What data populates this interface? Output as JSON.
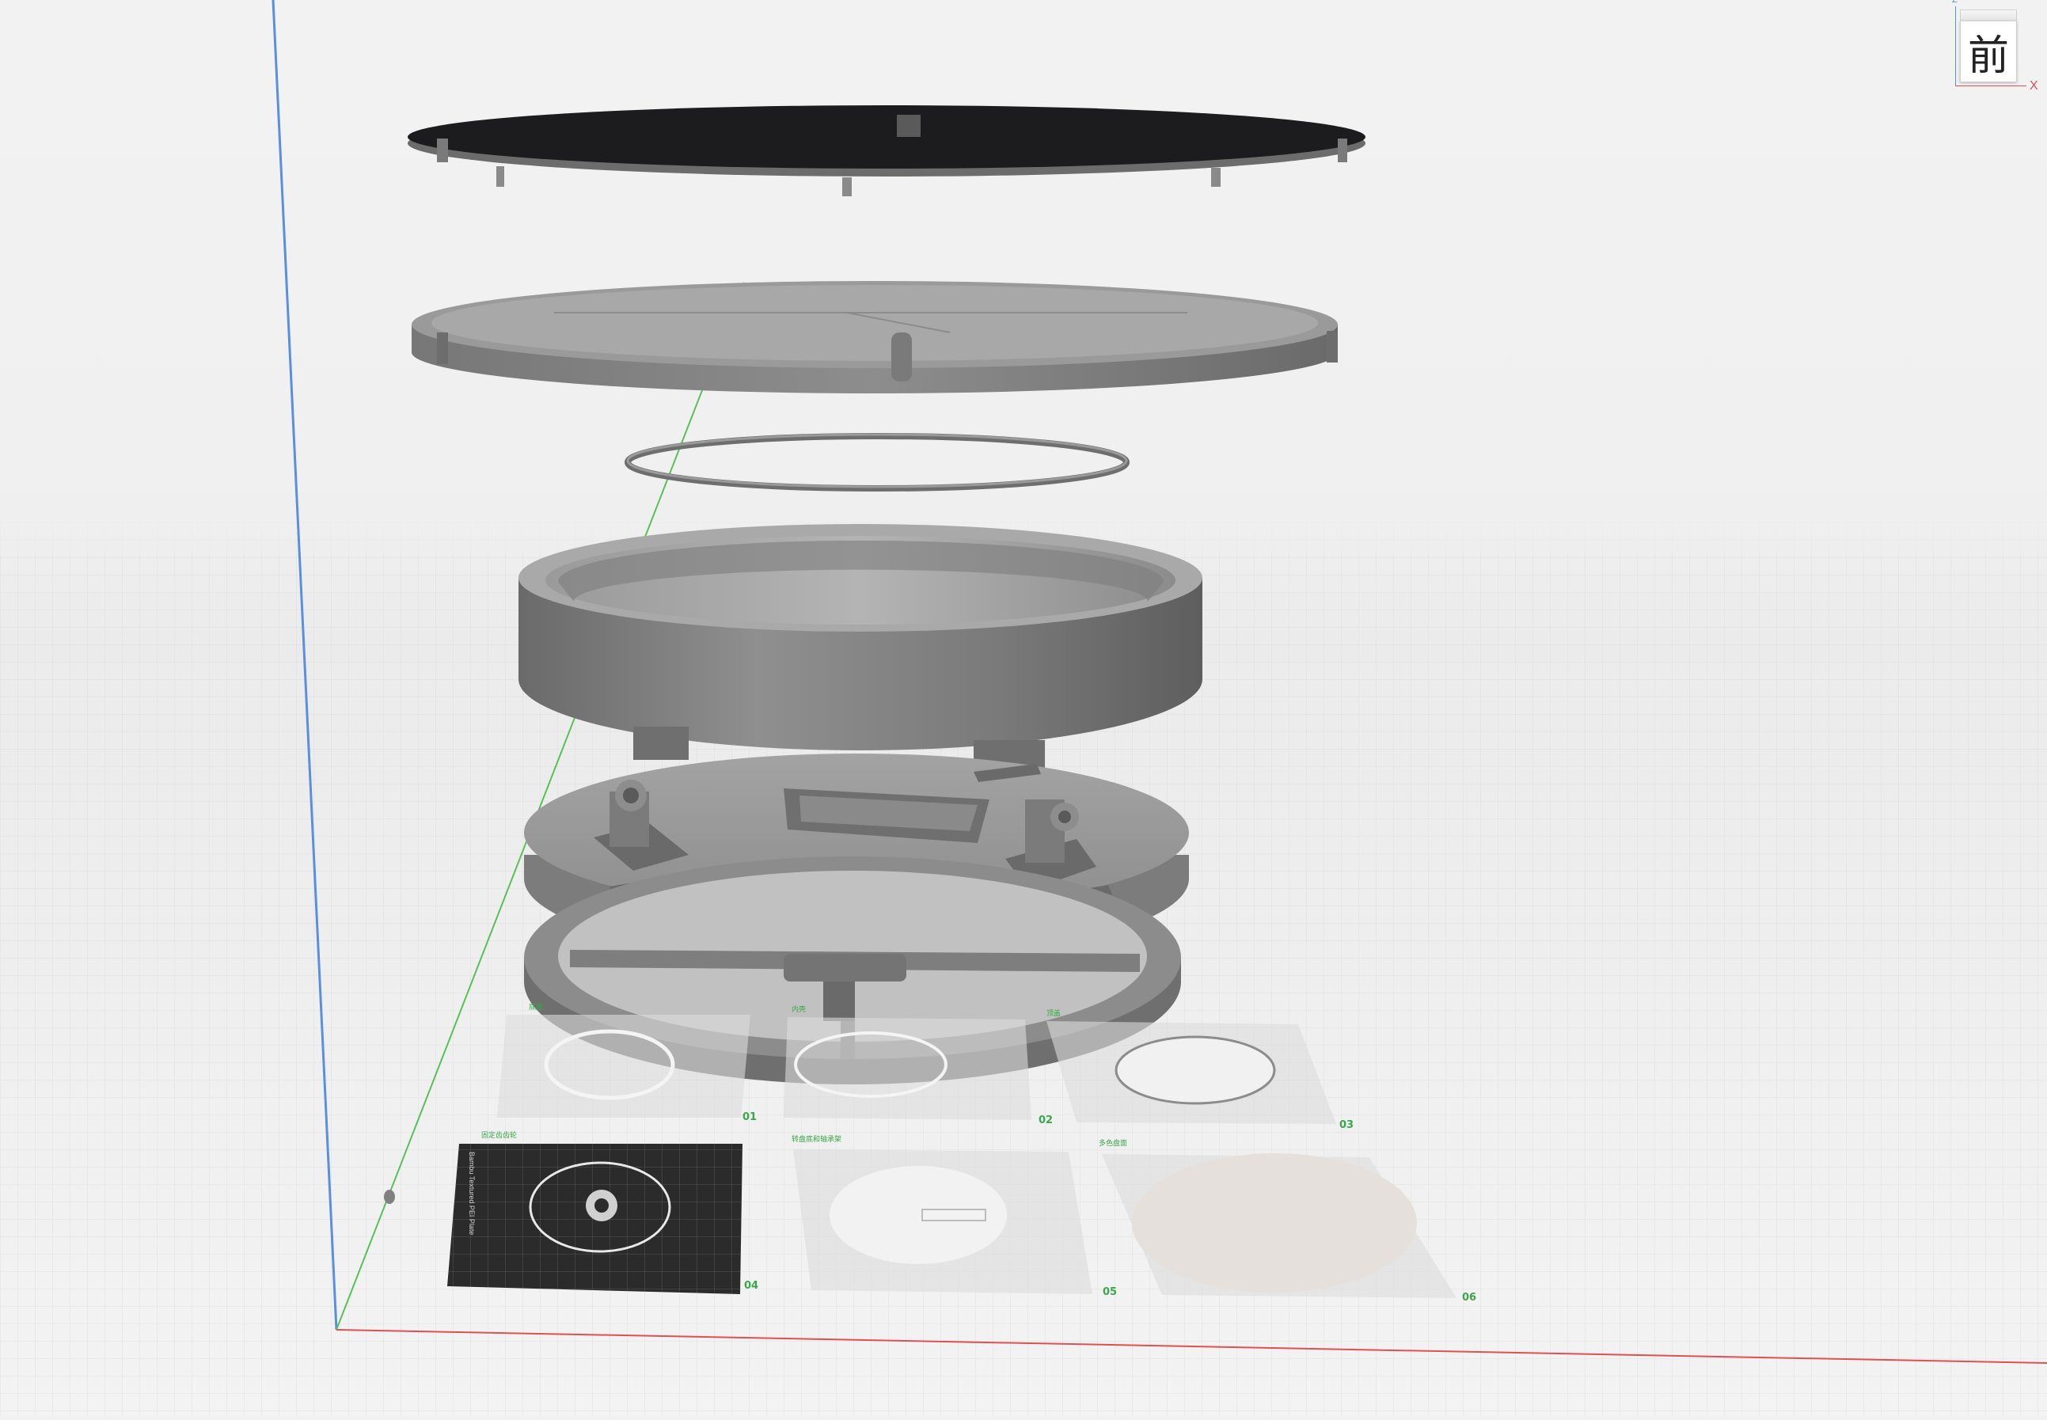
{
  "view_cube": {
    "face_label": "前",
    "axis_x_label": "X",
    "axis_z_label": "Z"
  },
  "plates": [
    {
      "number": "01",
      "name": "底座"
    },
    {
      "number": "02",
      "name": "内壳"
    },
    {
      "number": "03",
      "name": "顶盖"
    },
    {
      "number": "04",
      "name": "固定齿齿轮"
    },
    {
      "number": "05",
      "name": "转盘底和轴承架"
    },
    {
      "number": "06",
      "name": "多色盘面"
    }
  ],
  "active_plate_label": "Bambu Textured PEI Plate",
  "colors": {
    "background": "#f1f1f1",
    "grid": "#d6d6d6",
    "axis_x": "#e05050",
    "axis_y": "#56c156",
    "axis_z": "#5a8fe0",
    "plate_label": "#3aa84a",
    "model_gray": "#8a8a8a"
  }
}
